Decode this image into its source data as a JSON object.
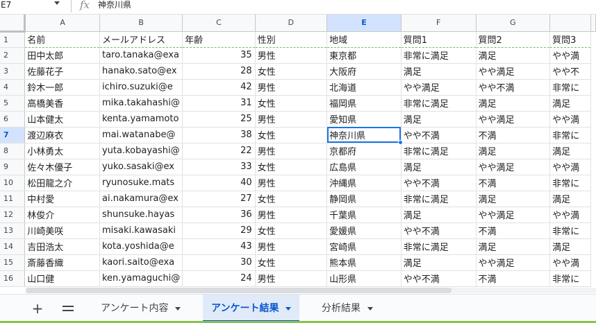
{
  "formula_bar": {
    "name_box": "E7",
    "fx_symbol": "fx",
    "formula": "神奈川県"
  },
  "columns": [
    "A",
    "B",
    "C",
    "D",
    "E",
    "F",
    "G",
    ""
  ],
  "selected_column": "E",
  "rows": [
    [
      "1",
      "名前",
      "メールアドレス",
      "年齢",
      "性別",
      "地域",
      "質問1",
      "質問2",
      "質問3"
    ],
    [
      "2",
      "田中太郎",
      "taro.tanaka@exa",
      "35",
      "男性",
      "東京都",
      "非常に満足",
      "満足",
      "やや満"
    ],
    [
      "3",
      "佐藤花子",
      "hanako.sato@ex",
      "28",
      "女性",
      "大阪府",
      "満足",
      "やや満足",
      "やや不"
    ],
    [
      "4",
      "鈴木一郎",
      "ichiro.suzuki@e",
      "42",
      "男性",
      "北海道",
      "やや満足",
      "やや不満",
      "非常に"
    ],
    [
      "5",
      "高橋美香",
      "mika.takahashi@",
      "31",
      "女性",
      "福岡県",
      "非常に満足",
      "満足",
      "満足"
    ],
    [
      "6",
      "山本健太",
      "kenta.yamamoto",
      "25",
      "男性",
      "愛知県",
      "満足",
      "やや満足",
      "やや満"
    ],
    [
      "7",
      "渡辺麻衣",
      "mai.watanabe@",
      "38",
      "女性",
      "神奈川県",
      "やや不満",
      "不満",
      "非常に"
    ],
    [
      "8",
      "小林勇太",
      "yuta.kobayashi@",
      "22",
      "男性",
      "京都府",
      "非常に満足",
      "満足",
      "満足"
    ],
    [
      "9",
      "佐々木優子",
      "yuko.sasaki@ex",
      "33",
      "女性",
      "広島県",
      "満足",
      "やや満足",
      "やや満"
    ],
    [
      "10",
      "松田龍之介",
      "ryunosuke.mats",
      "40",
      "男性",
      "沖縄県",
      "やや不満",
      "不満",
      "非常に"
    ],
    [
      "11",
      "中村愛",
      "ai.nakamura@ex",
      "27",
      "女性",
      "静岡県",
      "非常に満足",
      "満足",
      "満足"
    ],
    [
      "12",
      "林俊介",
      "shunsuke.hayas",
      "36",
      "男性",
      "千葉県",
      "満足",
      "やや満足",
      "やや満"
    ],
    [
      "13",
      "川崎美咲",
      "misaki.kawasaki",
      "29",
      "女性",
      "愛媛県",
      "やや不満",
      "不満",
      "非常に"
    ],
    [
      "14",
      "吉田浩太",
      "kota.yoshida@e",
      "43",
      "男性",
      "宮崎県",
      "非常に満足",
      "満足",
      "満足"
    ],
    [
      "15",
      "斎藤香織",
      "kaori.saito@exa",
      "30",
      "女性",
      "熊本県",
      "満足",
      "やや満足",
      "やや満"
    ],
    [
      "16",
      "山口健",
      "ken.yamaguchi@",
      "24",
      "男性",
      "山形県",
      "やや不満",
      "不満",
      "非常に"
    ]
  ],
  "active_cell": {
    "row": 7,
    "col": "E"
  },
  "sheet_tabs": [
    {
      "label": "アンケート内容",
      "active": false
    },
    {
      "label": "アンケート結果",
      "active": true
    },
    {
      "label": "分析結果",
      "active": false
    }
  ],
  "tab_bar": {
    "add_label": "+"
  },
  "colors": {
    "accent": "#1a73e8",
    "active_tab_text": "#0b57d0",
    "frozen_line": "#6fbf73",
    "bottom_accent": "#8bc34a"
  }
}
